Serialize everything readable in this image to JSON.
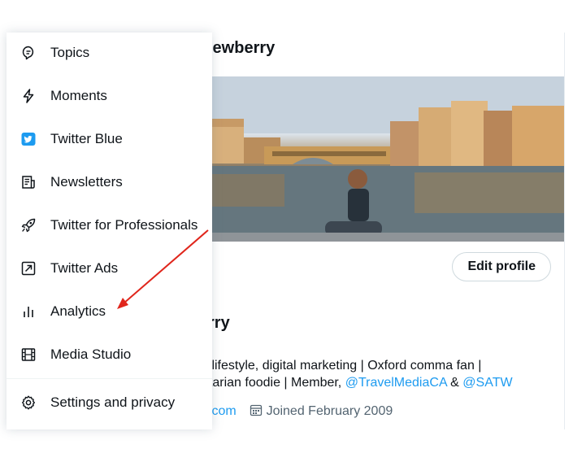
{
  "profile": {
    "header_name_partial": "lewberry",
    "edit_profile_label": "Edit profile",
    "short_name_partial": "rry",
    "bio_line1_text": "l, lifestyle, digital marketing | Oxford comma fan |",
    "bio_line2_text": "etarian foodie | Member, ",
    "bio_mention1": "@TravelMediaCA",
    "bio_amp": " & ",
    "bio_mention2": "@SATW",
    "website_partial": ".com",
    "joined_text": "Joined February 2009"
  },
  "menu": {
    "items": [
      {
        "label": "Topics",
        "icon": "topics-icon"
      },
      {
        "label": "Moments",
        "icon": "moments-icon"
      },
      {
        "label": "Twitter Blue",
        "icon": "twitter-blue-icon"
      },
      {
        "label": "Newsletters",
        "icon": "newsletters-icon"
      },
      {
        "label": "Twitter for Professionals",
        "icon": "rocket-icon"
      },
      {
        "label": "Twitter Ads",
        "icon": "ads-icon"
      },
      {
        "label": "Analytics",
        "icon": "analytics-icon"
      },
      {
        "label": "Media Studio",
        "icon": "media-studio-icon"
      },
      {
        "label": "Settings and privacy",
        "icon": "gear-icon"
      }
    ]
  },
  "colors": {
    "link": "#1d9bf0",
    "arrow": "#e0261c",
    "text": "#0f1419",
    "muted": "#536471"
  }
}
